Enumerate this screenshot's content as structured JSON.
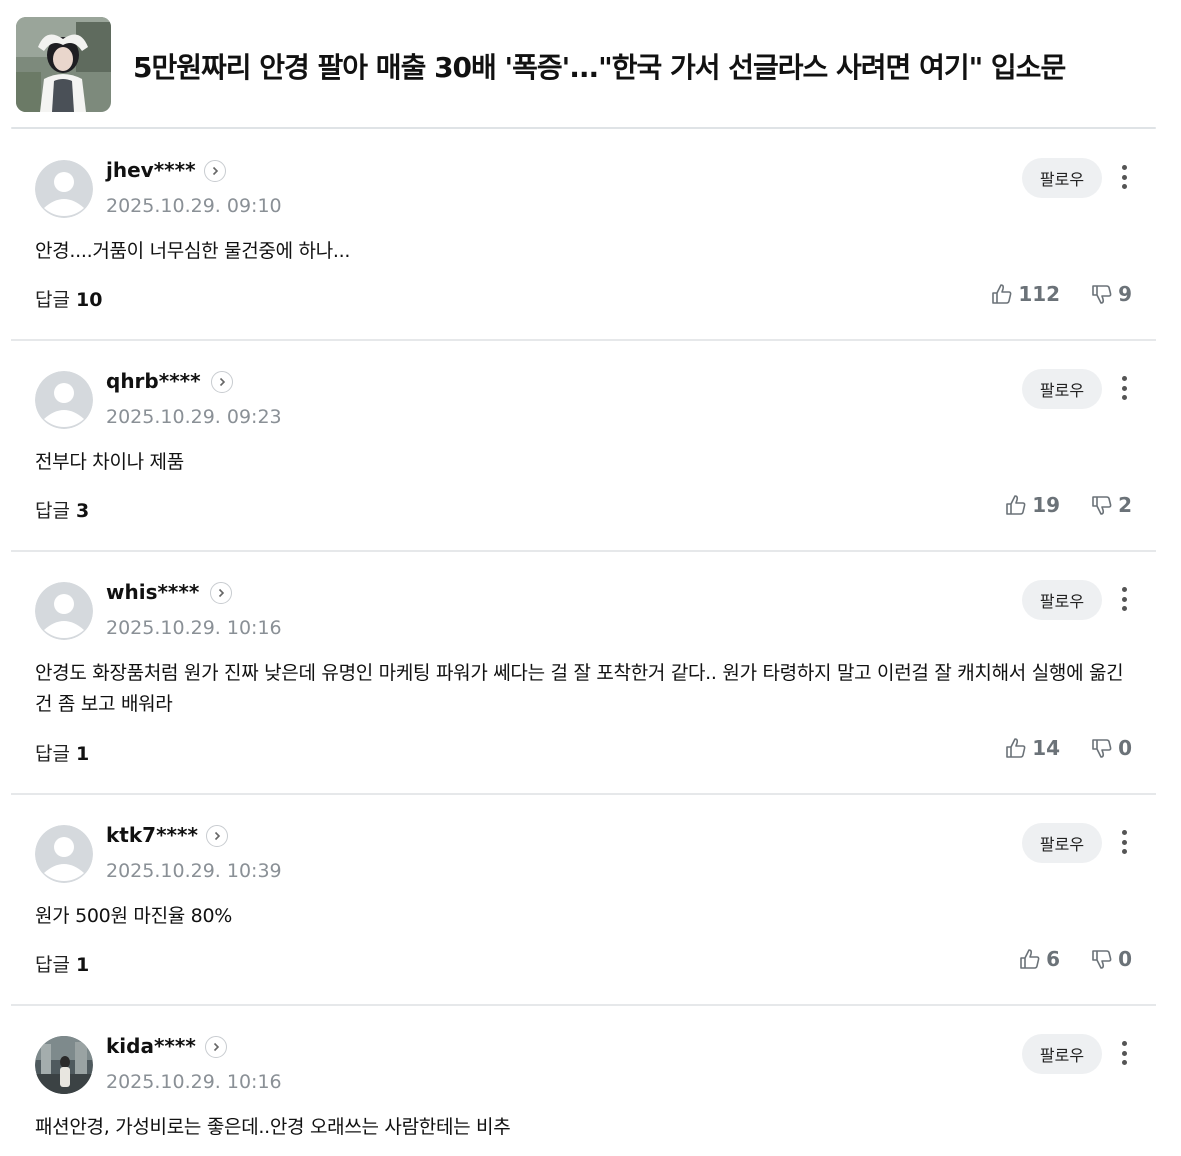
{
  "article": {
    "title": "5만원짜리 안경 팔아 매출 30배 '폭증'...\"한국 가서 선글라스 사려면 여기\" 입소문"
  },
  "comments": [
    {
      "username": "jhev****",
      "date": "2025.10.29. 09:10",
      "text": "안경....거품이 너무심한 물건중에 하나...",
      "reply_label": "답글",
      "reply_count": "10",
      "likes": "112",
      "dislikes": "9",
      "follow_label": "팔로우",
      "avatar": "default"
    },
    {
      "username": "qhrb****",
      "date": "2025.10.29. 09:23",
      "text": "전부다 차이나 제품",
      "reply_label": "답글",
      "reply_count": "3",
      "likes": "19",
      "dislikes": "2",
      "follow_label": "팔로우",
      "avatar": "default"
    },
    {
      "username": "whis****",
      "date": "2025.10.29. 10:16",
      "text": "안경도 화장품처럼 원가 진짜 낮은데 유명인 마케팅 파워가 쎄다는 걸 잘 포착한거 같다.. 원가 타령하지 말고 이런걸 잘 캐치해서 실행에 옮긴건 좀 보고 배워라",
      "reply_label": "답글",
      "reply_count": "1",
      "likes": "14",
      "dislikes": "0",
      "follow_label": "팔로우",
      "avatar": "default"
    },
    {
      "username": "ktk7****",
      "date": "2025.10.29. 10:39",
      "text": "원가 500원 마진율 80%",
      "reply_label": "답글",
      "reply_count": "1",
      "likes": "6",
      "dislikes": "0",
      "follow_label": "팔로우",
      "avatar": "default"
    },
    {
      "username": "kida****",
      "date": "2025.10.29. 10:16",
      "text": "패션안경, 가성비로는 좋은데..안경 오래쓰는 사람한테는 비추",
      "follow_label": "팔로우",
      "avatar": "photo"
    }
  ],
  "colors": {
    "muted": "#8a9096",
    "vote": "#6b7278",
    "follow_bg": "#eef0f2",
    "separator": "#e6e8ea"
  }
}
